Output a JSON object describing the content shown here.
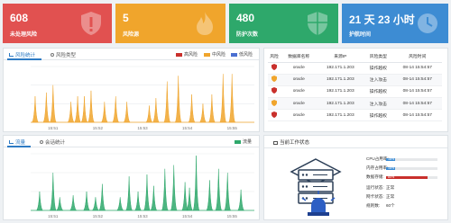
{
  "cards": [
    {
      "value": "608",
      "label": "未处理风险",
      "icon": "shield-alert-icon",
      "color": "#e15150"
    },
    {
      "value": "5",
      "label": "风险源",
      "icon": "fire-icon",
      "color": "#f0a52c"
    },
    {
      "value": "480",
      "label": "防护次数",
      "icon": "shield-check-icon",
      "color": "#2ea86b"
    },
    {
      "value": "21 天 23 小时",
      "label": "护航时间",
      "icon": "clock-icon",
      "color": "#3d8cd3"
    }
  ],
  "risk_panel": {
    "tabs": [
      "风险统计",
      "风险类型"
    ],
    "legend": [
      {
        "label": "高风险",
        "color": "#c9302c"
      },
      {
        "label": "中风险",
        "color": "#f0a52c"
      },
      {
        "label": "低风险",
        "color": "#4a6fd1"
      }
    ],
    "x_ticks": [
      "15:51",
      "15:52",
      "15:53",
      "15:54",
      "15:55"
    ]
  },
  "risk_table": {
    "headers": [
      "风险",
      "数据库名称",
      "来源IP",
      "风险类型",
      "风险时间"
    ],
    "rows": [
      {
        "severity": "high",
        "db": "oracle",
        "ip": "192.171.1.203",
        "type": "操作越权",
        "time": "08-14 15:54:57"
      },
      {
        "severity": "medium",
        "db": "oracle",
        "ip": "192.171.1.203",
        "type": "注入攻击",
        "time": "08-14 15:54:57"
      },
      {
        "severity": "high",
        "db": "oracle",
        "ip": "192.171.1.203",
        "type": "操作越权",
        "time": "08-14 15:54:57"
      },
      {
        "severity": "medium",
        "db": "oracle",
        "ip": "192.171.1.203",
        "type": "注入攻击",
        "time": "08-14 15:54:57"
      },
      {
        "severity": "high",
        "db": "oracle",
        "ip": "192.171.1.203",
        "type": "操作越权",
        "time": "08-14 15:54:57"
      }
    ]
  },
  "traffic_panel": {
    "tabs": [
      "流量",
      "会话统计"
    ],
    "legend": [
      {
        "label": "流量",
        "color": "#2ea86b"
      }
    ],
    "x_ticks": [
      "15:51",
      "15:52",
      "15:53",
      "15:54",
      "15:55"
    ]
  },
  "status_panel": {
    "title": "当前工作状态",
    "rows": [
      {
        "label": "CPU占用率:",
        "kind": "bar",
        "value": "18%",
        "fraction": 0.18,
        "color": "#3d8cd3"
      },
      {
        "label": "内存占用率:",
        "kind": "bar",
        "value": "18%",
        "fraction": 0.18,
        "color": "#3d8cd3"
      },
      {
        "label": "数据存储:",
        "kind": "bar",
        "value": "80%",
        "fraction": 0.8,
        "color": "#c9302c"
      },
      {
        "label": "运行状态:",
        "kind": "text",
        "value": "正常"
      },
      {
        "label": "网卡状态:",
        "kind": "text",
        "value": "正常"
      },
      {
        "label": "规则数:",
        "kind": "text",
        "value": "60个"
      }
    ]
  },
  "chart_data": [
    {
      "type": "area",
      "x": [
        "15:51",
        "15:52",
        "15:53",
        "15:54",
        "15:55"
      ],
      "series": [
        {
          "name": "中风险",
          "color": "#f0a52c",
          "peaks": [
            [
              0.02,
              1.4
            ],
            [
              0.07,
              1.6
            ],
            [
              0.1,
              2.0
            ],
            [
              0.18,
              1.1
            ],
            [
              0.21,
              1.4
            ],
            [
              0.24,
              1.4
            ],
            [
              0.27,
              1.7
            ],
            [
              0.33,
              1.1
            ],
            [
              0.38,
              1.4
            ],
            [
              0.43,
              1.1
            ],
            [
              0.53,
              0.9
            ],
            [
              0.56,
              1.3
            ],
            [
              0.61,
              2.2
            ],
            [
              0.66,
              2.5
            ],
            [
              0.72,
              1.5
            ],
            [
              0.77,
              1.0
            ],
            [
              0.81,
              1.5
            ],
            [
              0.86,
              2.6
            ],
            [
              0.9,
              2.6
            ]
          ]
        }
      ],
      "ylim": [
        0,
        3
      ]
    },
    {
      "type": "area",
      "x": [
        "15:51",
        "15:52",
        "15:53",
        "15:54",
        "15:55"
      ],
      "series": [
        {
          "name": "流量",
          "color": "#2ea86b",
          "peaks": [
            [
              0.04,
              1.0
            ],
            [
              0.1,
              2.0
            ],
            [
              0.13,
              0.7
            ],
            [
              0.19,
              0.8
            ],
            [
              0.25,
              1.0
            ],
            [
              0.29,
              0.7
            ],
            [
              0.32,
              1.4
            ],
            [
              0.4,
              0.7
            ],
            [
              0.44,
              1.8
            ],
            [
              0.48,
              1.0
            ],
            [
              0.52,
              1.9
            ],
            [
              0.55,
              1.3
            ],
            [
              0.6,
              2.2
            ],
            [
              0.64,
              2.4
            ],
            [
              0.69,
              1.5
            ],
            [
              0.71,
              1.2
            ],
            [
              0.74,
              2.9
            ],
            [
              0.8,
              1.6
            ],
            [
              0.84,
              2.2
            ],
            [
              0.88,
              2.0
            ],
            [
              0.94,
              1.1
            ]
          ]
        }
      ],
      "ylim": [
        0,
        3
      ]
    }
  ]
}
